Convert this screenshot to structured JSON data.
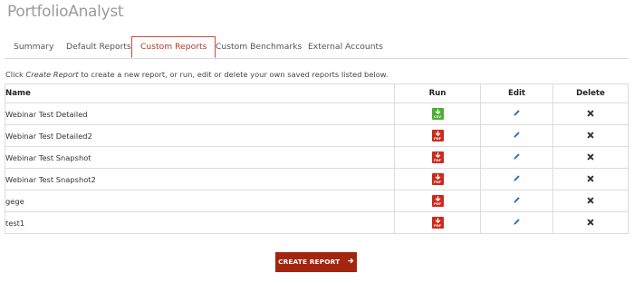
{
  "app": {
    "title": "PortfolioAnalyst"
  },
  "tabs": [
    {
      "label": "Summary"
    },
    {
      "label": "Default Reports"
    },
    {
      "label": "Custom Reports"
    },
    {
      "label": "Custom Benchmarks"
    },
    {
      "label": "External Accounts"
    }
  ],
  "active_tab": "Custom Reports",
  "intro": {
    "prefix": "Click ",
    "emphasis": "Create Report",
    "suffix": " to create a new report, or run, edit or delete your own saved reports listed below."
  },
  "table": {
    "headers": {
      "name": "Name",
      "run": "Run",
      "edit": "Edit",
      "delete": "Delete"
    },
    "rows": [
      {
        "name": "Webinar Test Detailed",
        "format": "CSV"
      },
      {
        "name": "Webinar Test Detailed2",
        "format": "PDF"
      },
      {
        "name": "Webinar Test Snapshot",
        "format": "PDF"
      },
      {
        "name": "Webinar Test Snapshot2",
        "format": "PDF"
      },
      {
        "name": "gege",
        "format": "PDF"
      },
      {
        "name": "test1",
        "format": "PDF"
      }
    ],
    "icons": {
      "run": "download-file-icon",
      "edit": "pencil-icon",
      "delete": "close-x-icon"
    }
  },
  "create_button": {
    "label": "CREATE REPORT",
    "icon": "arrow-right-icon"
  },
  "colors": {
    "accent": "#a3250f",
    "tab_active": "#b23a26",
    "pdf": "#cc2a1e",
    "csv": "#4caf33",
    "edit_icon": "#2a6fb5"
  }
}
